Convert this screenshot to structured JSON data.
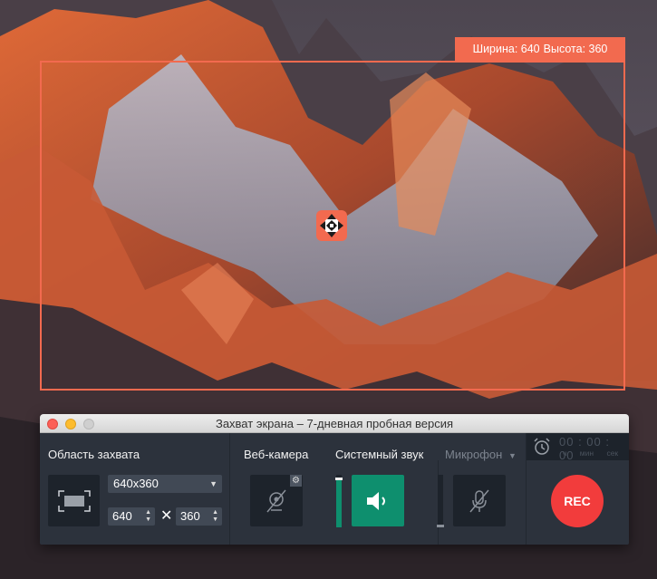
{
  "capture": {
    "size_label_width": "Ширина: 640",
    "size_label_height": "Высота: 360"
  },
  "window": {
    "title": "Захват экрана – 7-дневная пробная версия"
  },
  "capture_area": {
    "label": "Область захвата",
    "preset": "640x360",
    "width": "640",
    "height": "360",
    "separator": "✕"
  },
  "webcam": {
    "label": "Веб-камера",
    "enabled": false
  },
  "system_audio": {
    "label": "Системный звук",
    "enabled": true,
    "level": 0.95
  },
  "microphone": {
    "label": "Микрофон",
    "enabled": false,
    "level": 0.05
  },
  "timer": {
    "digits": "00 : 00 : 00",
    "units": "ч мин сек"
  },
  "rec": {
    "label": "REC"
  },
  "colors": {
    "accent": "#f26a4f",
    "active_tile": "#0e8f6e",
    "rec": "#f23c3c",
    "panel": "#2c323c"
  },
  "icons": [
    "move-handle-icon",
    "fullscreen-area-icon",
    "webcam-off-icon",
    "gear-icon",
    "speaker-icon",
    "microphone-off-icon",
    "alarm-clock-icon",
    "chevron-down-icon"
  ]
}
